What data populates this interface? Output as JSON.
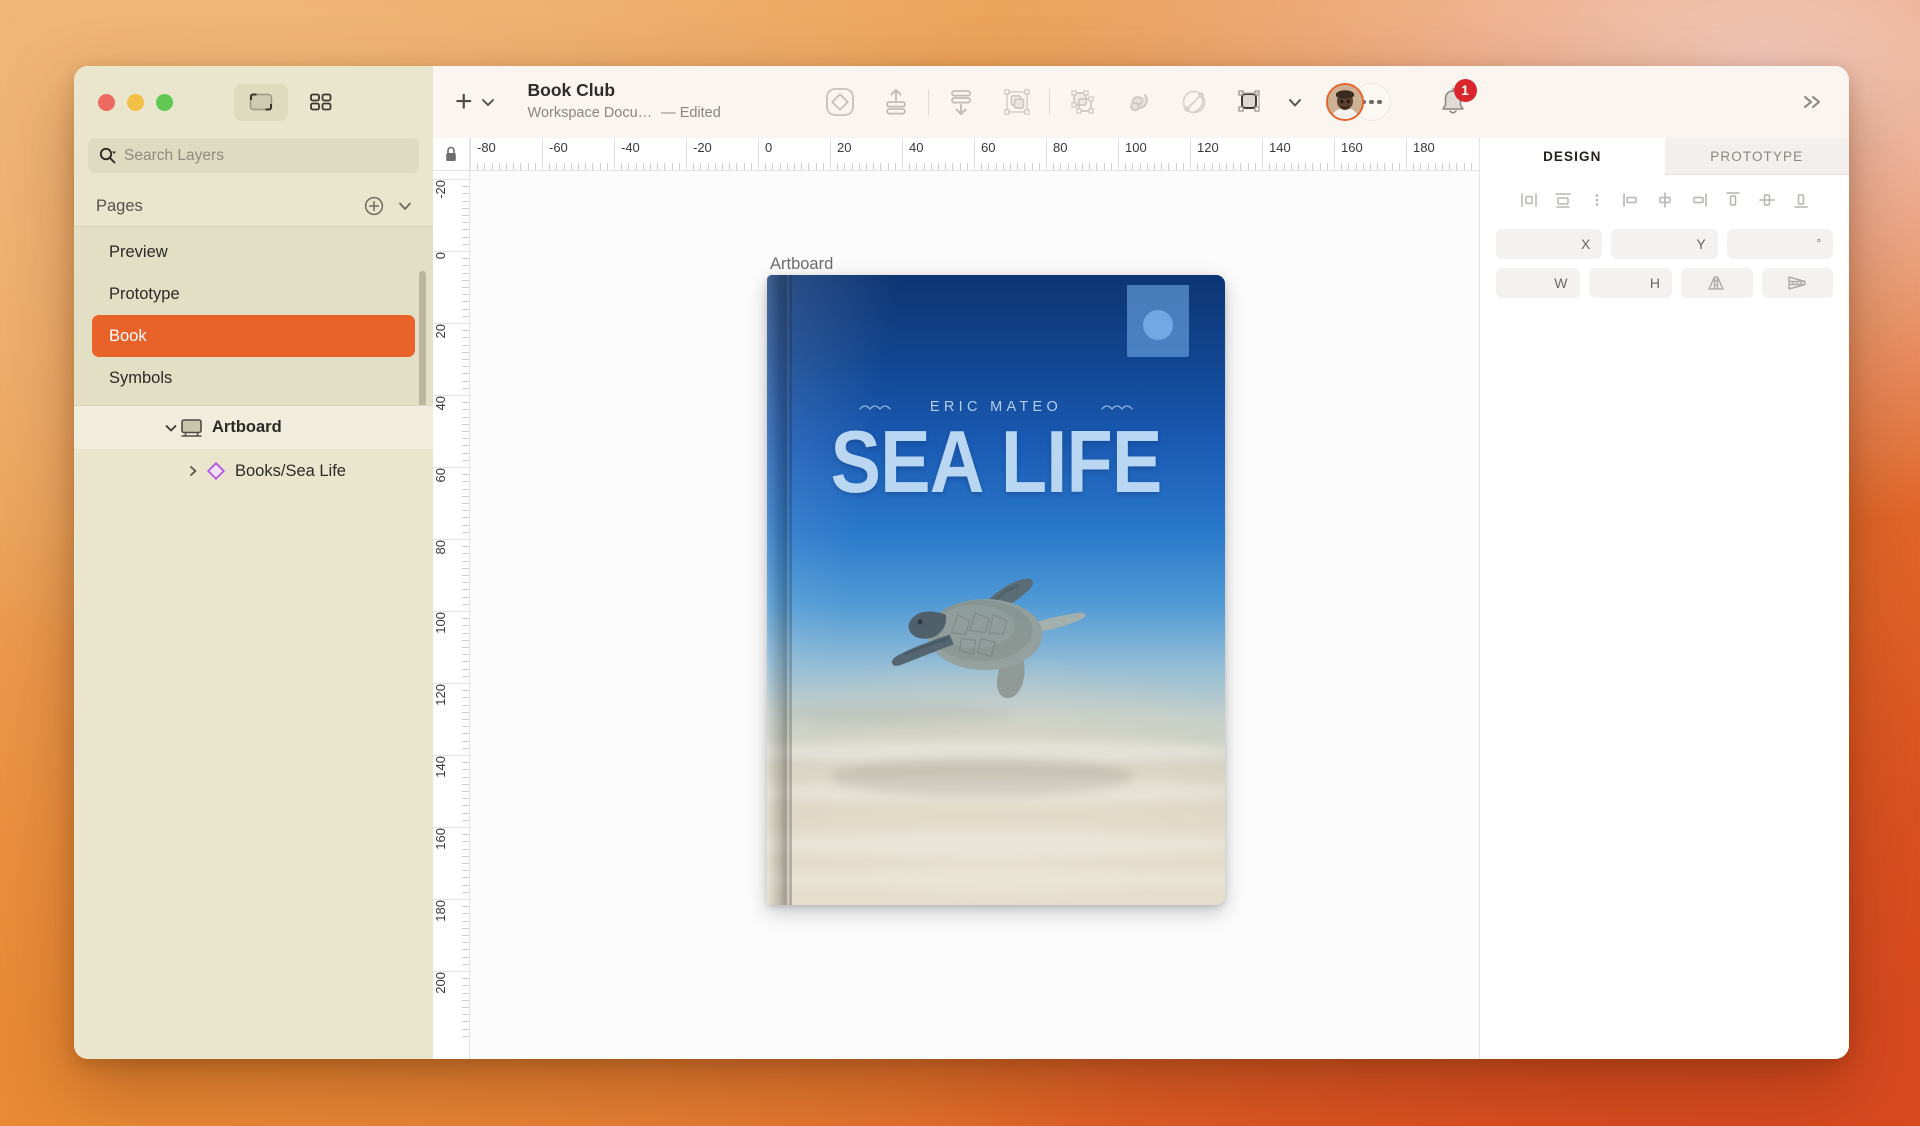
{
  "window": {
    "traffic_lights": [
      "close",
      "minimize",
      "maximize"
    ],
    "view_modes": [
      {
        "name": "artboard-view",
        "icon": "artboard-icon",
        "active": true
      },
      {
        "name": "grid-view",
        "icon": "grid-icon",
        "active": false
      }
    ]
  },
  "search": {
    "placeholder": "Search Layers",
    "icon": "search-icon"
  },
  "sidebar": {
    "pages_header": {
      "title": "Pages",
      "add_icon": "plus-circle-icon",
      "collapse_icon": "chevron-down-icon"
    },
    "pages": [
      {
        "label": "Preview",
        "selected": false
      },
      {
        "label": "Prototype",
        "selected": false
      },
      {
        "label": "Book",
        "selected": true
      },
      {
        "label": "Symbols",
        "selected": false
      }
    ],
    "layers": [
      {
        "label": "Artboard",
        "icon": "artboard-icon",
        "disclosure": "chevron-down-icon",
        "expanded": true,
        "indent": 0
      },
      {
        "label": "Books/Sea Life",
        "icon": "symbol-diamond-icon",
        "disclosure": "chevron-right-icon",
        "expanded": false,
        "indent": 1
      }
    ]
  },
  "toolbar": {
    "add_label": "+",
    "add_dropdown_icon": "chevron-down-icon",
    "doc_title": "Book Club",
    "doc_subtitle": "Workspace Docu…",
    "doc_status": "— Edited",
    "buttons": [
      {
        "name": "insert-symbol-button",
        "icon": "symbol-diamond-rounded-icon"
      },
      {
        "name": "move-to-front-button",
        "icon": "align-up-icon"
      },
      {
        "name": "move-to-back-button",
        "icon": "align-down-icon"
      },
      {
        "name": "group-button",
        "icon": "group-shapes-icon"
      },
      {
        "name": "union-button",
        "icon": "boolean-union-icon"
      },
      {
        "name": "mask-button",
        "icon": "mask-swirl-icon"
      },
      {
        "name": "scale-button",
        "icon": "scale-oval-icon"
      },
      {
        "name": "shape-tools-button",
        "icon": "rounded-rect-handles-icon"
      }
    ],
    "shape_dropdown_icon": "chevron-down-icon",
    "avatar": {
      "name": "user-avatar",
      "ring_color": "#e8622a"
    },
    "avatar_more_icon": "ellipsis-icon",
    "notifications": {
      "icon": "bell-icon",
      "count": "1",
      "badge_color": "#d8262c"
    },
    "overflow_icon": "chevron-double-right-icon"
  },
  "canvas": {
    "artboard_label": "Artboard",
    "ruler_lock_icon": "lock-icon",
    "ruler_h": [
      "-80",
      "-60",
      "-40",
      "-20",
      "0",
      "20",
      "40",
      "60",
      "80",
      "100",
      "120",
      "140",
      "160",
      "180"
    ],
    "ruler_v": [
      "-20",
      "0",
      "20",
      "40",
      "60",
      "80",
      "100",
      "120",
      "140",
      "160",
      "180",
      "200"
    ]
  },
  "book_cover": {
    "author": "ERIC MATEO",
    "title": "SEA LIFE",
    "wave_left_icon": "wave-icon",
    "wave_right_icon": "wave-icon",
    "photo_subject": "sea-turtle-underwater",
    "badge": "cover-badge-circle"
  },
  "inspector": {
    "tabs": [
      {
        "label": "DESIGN",
        "active": true
      },
      {
        "label": "PROTOTYPE",
        "active": false
      }
    ],
    "align_buttons": [
      {
        "name": "align-left-icon"
      },
      {
        "name": "distribute-horizontal-icon"
      },
      {
        "name": "more-align-icon"
      },
      {
        "name": "align-object-left-icon"
      },
      {
        "name": "align-object-center-icon"
      },
      {
        "name": "align-object-right-icon"
      },
      {
        "name": "align-object-top-icon"
      },
      {
        "name": "align-object-middle-icon"
      },
      {
        "name": "align-object-bottom-icon"
      }
    ],
    "fields_row1": [
      {
        "name": "x-field",
        "label": "X",
        "value": ""
      },
      {
        "name": "y-field",
        "label": "Y",
        "value": ""
      },
      {
        "name": "rotation-field",
        "label": "°",
        "value": ""
      }
    ],
    "fields_row2": [
      {
        "name": "w-field",
        "label": "W",
        "value": ""
      },
      {
        "name": "h-field",
        "label": "H",
        "value": ""
      },
      {
        "name": "flip-horizontal-button",
        "icon": "flip-horizontal-icon"
      },
      {
        "name": "flip-vertical-button",
        "icon": "flip-vertical-icon"
      }
    ]
  }
}
